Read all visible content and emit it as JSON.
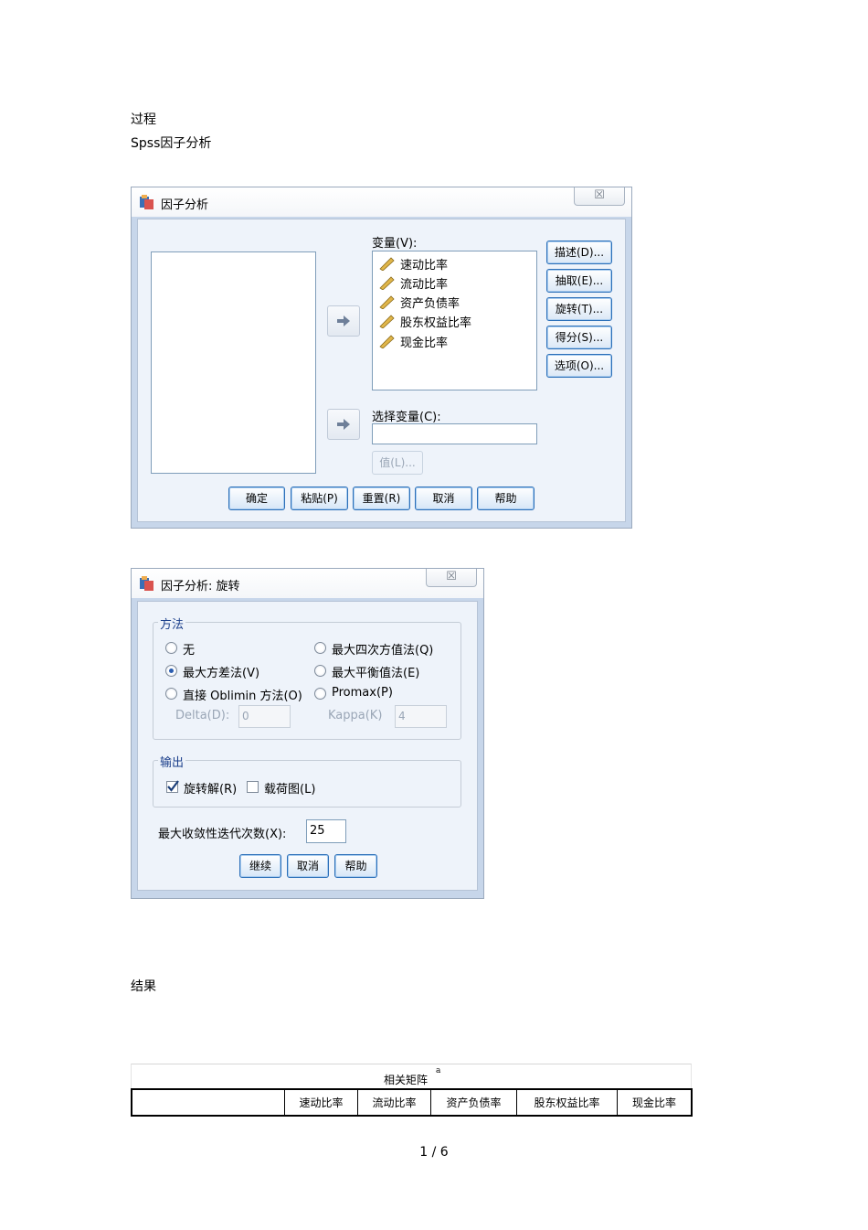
{
  "doc": {
    "heading_process": "过程",
    "heading_spss": "Spss因子分析",
    "heading_result": "结果",
    "page_number": "1 / 6"
  },
  "factor_dialog": {
    "title": "因子分析",
    "close_glyph": "☒",
    "variables_label": "变量(V):",
    "variables": [
      "速动比率",
      "流动比率",
      "资产负债率",
      "股东权益比率",
      "现金比率"
    ],
    "selection_label": "选择变量(C):",
    "value_button": "值(L)...",
    "side_buttons": [
      "描述(D)...",
      "抽取(E)...",
      "旋转(T)...",
      "得分(S)...",
      "选项(O)..."
    ],
    "bottom_buttons": [
      "确定",
      "粘贴(P)",
      "重置(R)",
      "取消",
      "帮助"
    ]
  },
  "rotation_dialog": {
    "title": "因子分析: 旋转",
    "close_glyph": "☒",
    "method_legend": "方法",
    "methods": {
      "none": "无",
      "quartimax": "最大四次方值法(Q)",
      "varimax": "最大方差法(V)",
      "equamax": "最大平衡值法(E)",
      "oblimin": "直接 Oblimin 方法(O)",
      "promax": "Promax(P)"
    },
    "selected_method": "varimax",
    "delta_label": "Delta(D):",
    "delta_value": "0",
    "kappa_label": "Kappa(K)",
    "kappa_value": "4",
    "output_legend": "输出",
    "rotated_solution_label": "旋转解(R)",
    "rotated_solution_checked": true,
    "loading_plot_label": "载荷图(L)",
    "loading_plot_checked": false,
    "max_iter_label": "最大收敛性迭代次数(X):",
    "max_iter_value": "25",
    "buttons": [
      "继续",
      "取消",
      "帮助"
    ]
  },
  "table": {
    "title": "相关矩阵",
    "title_mark": "a",
    "columns": [
      "",
      "速动比率",
      "流动比率",
      "资产负债率",
      "股东权益比率",
      "现金比率"
    ]
  },
  "colors": {
    "button_border": "#2b6fb8",
    "dialog_bg": "#eef3fa",
    "legend_text": "#1b3f8b"
  }
}
